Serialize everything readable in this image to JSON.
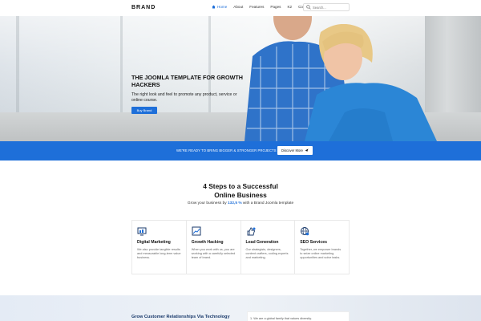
{
  "header": {
    "brand": "BRAND",
    "nav": [
      {
        "label": "Home",
        "active": true,
        "icon": "home-icon"
      },
      {
        "label": "About"
      },
      {
        "label": "Features"
      },
      {
        "label": "Pages"
      },
      {
        "label": "K2"
      },
      {
        "label": "Contact"
      }
    ],
    "search_placeholder": "Search..."
  },
  "hero": {
    "title": "THE JOOMLA TEMPLATE FOR GROWTH HACKERS",
    "subtitle": "The right look and feel to promote any product, service or online course.",
    "button": "Buy Brand",
    "slides": 3,
    "active_slide": 1
  },
  "banner": {
    "text": "WE'RE READY TO BRING BIGGER & STRONGER PROJECTS",
    "button": "Discover More",
    "button_icon": "send-icon"
  },
  "steps": {
    "title_line1": "4 Steps to a Successful",
    "title_line2": "Online Business",
    "sub_before": "Grow your business by ",
    "sub_pct": "132,5 %",
    "sub_after": " with a Brand Joomla template",
    "cards": [
      {
        "icon": "digital-marketing-icon",
        "title": "Digital Marketing",
        "text": "We also provide tangible results and measurable long-term value business."
      },
      {
        "icon": "growth-hacking-icon",
        "title": "Growth Hacking",
        "text": "When you work with us, you are working with a carefully selected team of brand."
      },
      {
        "icon": "lead-generation-icon",
        "title": "Lead Generation",
        "text": "Our strategists, designers, content crafters, coding experts and marketing."
      },
      {
        "icon": "seo-services-icon",
        "title": "SEO Services",
        "text": "Together, we empower brands to seize online marketing opportunities and solve tasks."
      }
    ]
  },
  "bottom": {
    "title": "Grow Customer Relationships Via Technology",
    "card_text": "1. We are a global family that values diversity."
  },
  "colors": {
    "accent": "#1e6fd9",
    "shirt_man": "#2f73c9",
    "shirt_woman": "#2b86d6"
  }
}
